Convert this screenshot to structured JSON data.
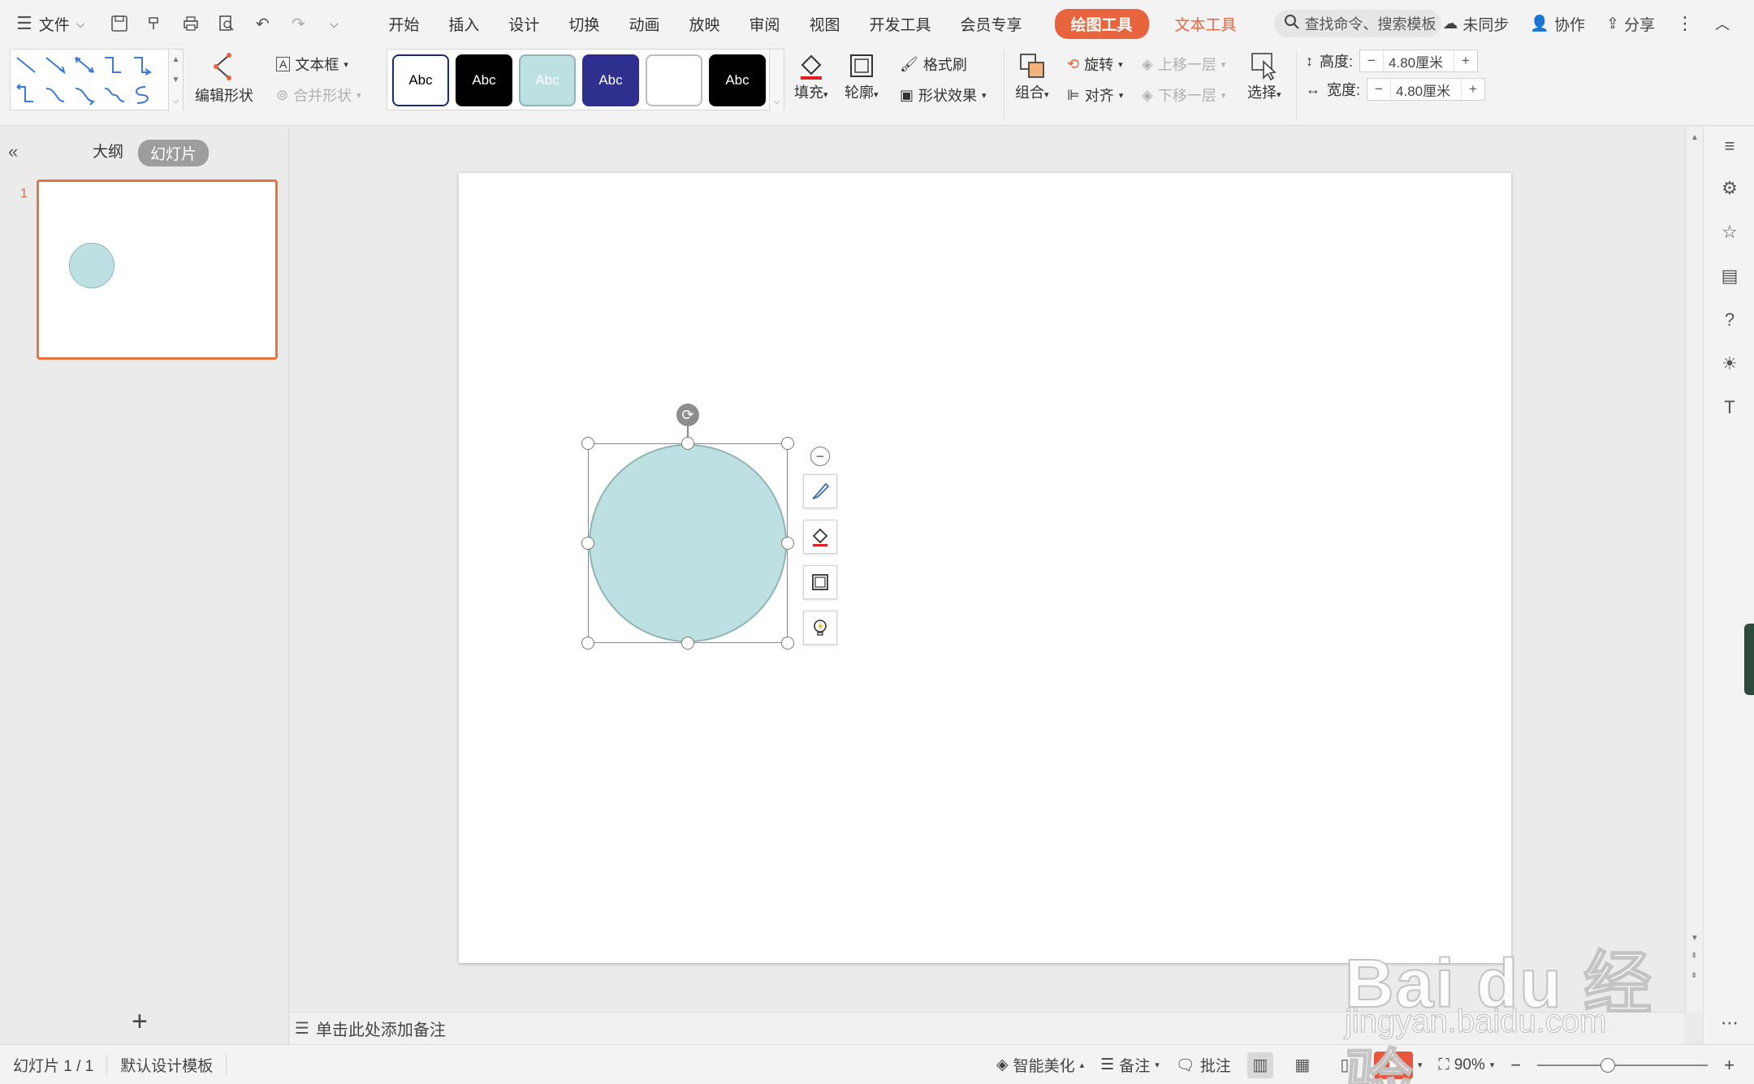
{
  "menubar": {
    "file_label": "文件",
    "tabs": [
      "开始",
      "插入",
      "设计",
      "切换",
      "动画",
      "放映",
      "审阅",
      "视图",
      "开发工具",
      "会员专享"
    ],
    "active_tab": "绘图工具",
    "text_tool_tab": "文本工具",
    "search_placeholder": "查找命令、搜索模板",
    "sync_label": "未同步",
    "collab_label": "协作",
    "share_label": "分享"
  },
  "ribbon": {
    "edit_shape": "编辑形状",
    "text_box": "文本框",
    "merge_shape": "合并形状",
    "styles": [
      {
        "label": "Abc",
        "bg": "#ffffff",
        "fg": "#000000",
        "border": "#1e2a78"
      },
      {
        "label": "Abc",
        "bg": "#000000",
        "fg": "#ffffff",
        "border": "#000000"
      },
      {
        "label": "Abc",
        "bg": "#bde0e3",
        "fg": "#ffffff",
        "border": "#8fb3b6"
      },
      {
        "label": "Abc",
        "bg": "#2e2f8f",
        "fg": "#ffffff",
        "border": "#2e2f8f"
      },
      {
        "label": "",
        "bg": "#ffffff",
        "fg": "#000000",
        "border": "#bdbdbd"
      },
      {
        "label": "Abc",
        "bg": "#000000",
        "fg": "#ffffff",
        "border": "#000000"
      }
    ],
    "fill": "填充",
    "outline": "轮廓",
    "format_painter": "格式刷",
    "shape_effect": "形状效果",
    "group": "组合",
    "rotate": "旋转",
    "align": "对齐",
    "bring_forward": "上移一层",
    "send_backward": "下移一层",
    "select": "选择",
    "height_label": "高度:",
    "height_value": "4.80厘米",
    "width_label": "宽度:",
    "width_value": "4.80厘米"
  },
  "leftpanel": {
    "outline_tab": "大纲",
    "slides_tab": "幻灯片",
    "slide_number": "1"
  },
  "slide": {
    "shape_fill": "#bde0e3",
    "shape_stroke": "#8fb3b6"
  },
  "notes": {
    "placeholder": "单击此处添加备注"
  },
  "statusbar": {
    "slide_info": "幻灯片 1 / 1",
    "template": "默认设计模板",
    "smart_beautify": "智能美化",
    "notes": "备注",
    "comments": "批注",
    "zoom": "90%"
  },
  "watermark": {
    "brand": "Bai du 经验",
    "url": "jingyan.baidu.com"
  },
  "colors": {
    "accent": "#e8643c",
    "selection_border": "#e8743c"
  }
}
